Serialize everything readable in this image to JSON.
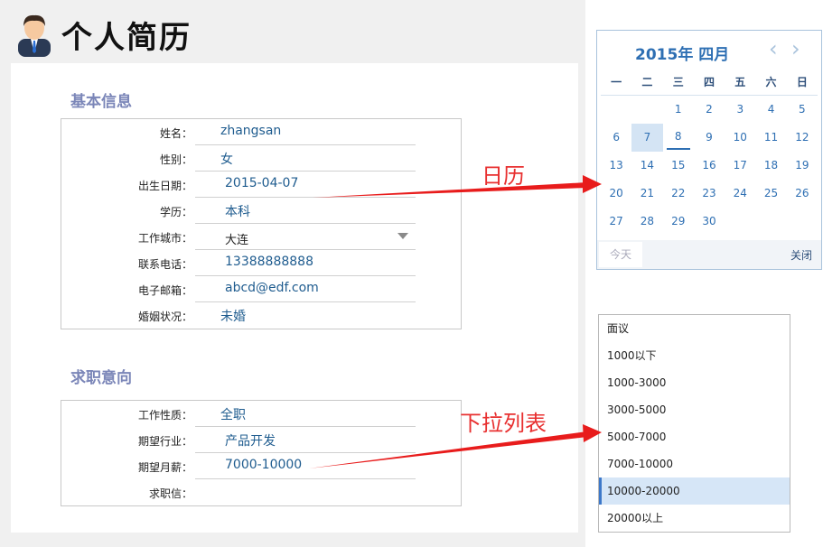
{
  "title": "个人简历",
  "sections": {
    "basic": {
      "title": "基本信息",
      "rows": [
        {
          "label": "姓名：",
          "value": "zhangsan"
        },
        {
          "label": "性别：",
          "value": "女"
        },
        {
          "label": "出生日期：",
          "value": "2015-04-07"
        },
        {
          "label": "学历：",
          "value": "本科"
        },
        {
          "label": "工作城市：",
          "value": "大连"
        },
        {
          "label": "联系电话：",
          "value": "13388888888"
        },
        {
          "label": "电子邮箱：",
          "value": "abcd@edf.com"
        },
        {
          "label": "婚姻状况：",
          "value": "未婚"
        }
      ]
    },
    "intent": {
      "title": "求职意向",
      "rows": [
        {
          "label": "工作性质：",
          "value": "全职"
        },
        {
          "label": "期望行业：",
          "value": "产品开发"
        },
        {
          "label": "期望月薪：",
          "value": "7000-10000"
        },
        {
          "label": "求职信：",
          "value": ""
        }
      ]
    }
  },
  "calendar": {
    "title": "2015年 四月",
    "weekdays": [
      "一",
      "二",
      "三",
      "四",
      "五",
      "六",
      "日"
    ],
    "days": [
      "",
      "",
      "1",
      "2",
      "3",
      "4",
      "5",
      "6",
      "7",
      "8",
      "9",
      "10",
      "11",
      "12",
      "13",
      "14",
      "15",
      "16",
      "17",
      "18",
      "19",
      "20",
      "21",
      "22",
      "23",
      "24",
      "25",
      "26",
      "27",
      "28",
      "29",
      "30",
      "",
      "",
      ""
    ],
    "selected_day": "7",
    "today_day": "8",
    "today_button": "今天",
    "close_button": "关闭"
  },
  "salary_options": [
    "面议",
    "1000以下",
    "1000-3000",
    "3000-5000",
    "5000-7000",
    "7000-10000",
    "10000-20000",
    "20000以上"
  ],
  "salary_selected_index": 6,
  "annotations": {
    "calendar": "日历",
    "dropdown": "下拉列表"
  },
  "colors": {
    "accent": "#2e6fb3",
    "section_title": "#7b86b8",
    "value_text": "#1f5c8f",
    "annotation": "#e83030"
  }
}
